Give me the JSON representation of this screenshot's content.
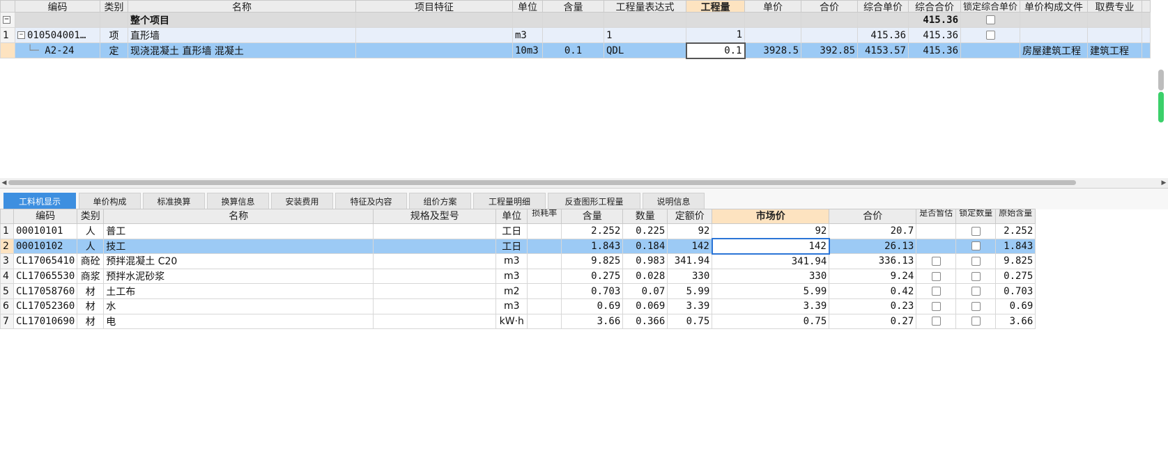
{
  "top_table": {
    "headers": [
      "编码",
      "类别",
      "名称",
      "项目特征",
      "单位",
      "含量",
      "工程量表达式",
      "工程量",
      "单价",
      "合价",
      "综合单价",
      "综合合价",
      "锁定综合单价",
      "单价构成文件",
      "取费专业"
    ],
    "group_row": {
      "name": "整个项目",
      "total": "415.36"
    },
    "item_row": {
      "num": "1",
      "code": "010504001…",
      "type": "项",
      "name": "直形墙",
      "unit": "m3",
      "expr": "1",
      "qty": "1",
      "unit_total": "415.36",
      "total": "415.36"
    },
    "sub_row": {
      "code": "A2-24",
      "type": "定",
      "name": "现浇混凝土 直形墙 混凝土",
      "unit": "10m3",
      "content": "0.1",
      "expr": "QDL",
      "qty": "0.1",
      "price": "3928.5",
      "sum": "392.85",
      "unit_total": "4153.57",
      "total": "415.36",
      "price_file": "房屋建筑工程",
      "fee_type": "建筑工程"
    }
  },
  "tabs": [
    "工料机显示",
    "单价构成",
    "标准换算",
    "换算信息",
    "安装费用",
    "特征及内容",
    "组价方案",
    "工程量明细",
    "反查图形工程量",
    "说明信息"
  ],
  "bottom_table": {
    "headers": [
      "编码",
      "类别",
      "名称",
      "规格及型号",
      "单位",
      "损耗率",
      "含量",
      "数量",
      "定额价",
      "市场价",
      "合价",
      "是否暂估",
      "锁定数量",
      "原始含量"
    ],
    "rows": [
      {
        "num": "1",
        "code": "00010101",
        "type": "人",
        "name": "普工",
        "unit": "工日",
        "content": "2.252",
        "qty": "0.225",
        "base": "92",
        "market": "92",
        "sum": "20.7",
        "orig": "2.252"
      },
      {
        "num": "2",
        "code": "00010102",
        "type": "人",
        "name": "技工",
        "unit": "工日",
        "content": "1.843",
        "qty": "0.184",
        "base": "142",
        "market": "142",
        "sum": "26.13",
        "orig": "1.843"
      },
      {
        "num": "3",
        "code": "CL17065410",
        "type": "商砼",
        "name": "预拌混凝土 C20",
        "unit": "m3",
        "content": "9.825",
        "qty": "0.983",
        "base": "341.94",
        "market": "341.94",
        "sum": "336.13",
        "orig": "9.825"
      },
      {
        "num": "4",
        "code": "CL17065530",
        "type": "商浆",
        "name": "预拌水泥砂浆",
        "unit": "m3",
        "content": "0.275",
        "qty": "0.028",
        "base": "330",
        "market": "330",
        "sum": "9.24",
        "orig": "0.275"
      },
      {
        "num": "5",
        "code": "CL17058760",
        "type": "材",
        "name": "土工布",
        "unit": "m2",
        "content": "0.703",
        "qty": "0.07",
        "base": "5.99",
        "market": "5.99",
        "sum": "0.42",
        "orig": "0.703"
      },
      {
        "num": "6",
        "code": "CL17052360",
        "type": "材",
        "name": "水",
        "unit": "m3",
        "content": "0.69",
        "qty": "0.069",
        "base": "3.39",
        "market": "3.39",
        "sum": "0.23",
        "orig": "0.69"
      },
      {
        "num": "7",
        "code": "CL17010690",
        "type": "材",
        "name": "电",
        "unit": "kW·h",
        "content": "3.66",
        "qty": "0.366",
        "base": "0.75",
        "market": "0.75",
        "sum": "0.27",
        "orig": "3.66"
      }
    ]
  },
  "colors": {
    "selected_row": "#9ccaf5",
    "highlight_header": "#fde3c0",
    "active_tab": "#3d8fe0"
  }
}
